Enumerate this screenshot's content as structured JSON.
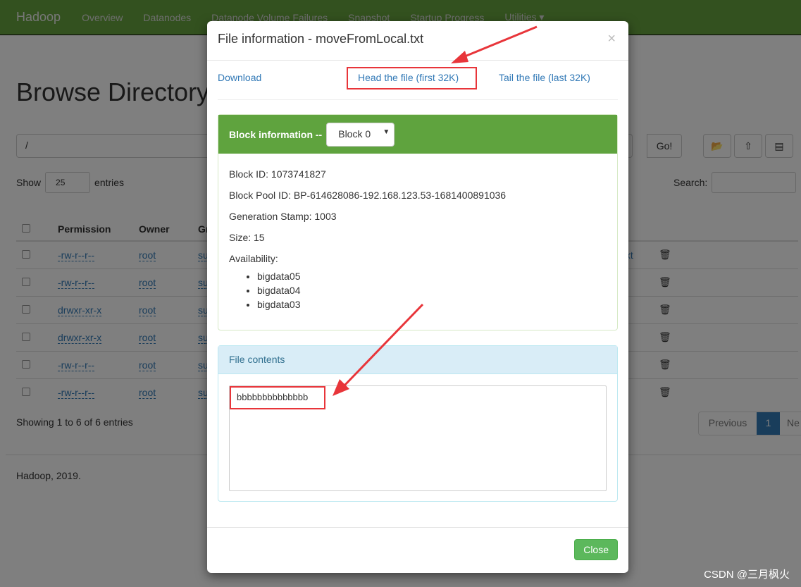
{
  "nav": {
    "brand": "Hadoop",
    "items": [
      "Overview",
      "Datanodes",
      "Datanode Volume Failures",
      "Snapshot",
      "Startup Progress",
      "Utilities ▾"
    ]
  },
  "page": {
    "title": "Browse Directory",
    "path": "/",
    "go": "Go!",
    "show": "Show",
    "entries_value": "25",
    "entries": "entries",
    "search": "Search:",
    "columns": [
      "Permission",
      "Owner",
      "Gr"
    ],
    "rows": [
      [
        "-rw-r--r--",
        "root",
        "su"
      ],
      [
        "-rw-r--r--",
        "root",
        "su"
      ],
      [
        "drwxr-xr-x",
        "root",
        "su"
      ],
      [
        "drwxr-xr-x",
        "root",
        "su"
      ],
      [
        "-rw-r--r--",
        "root",
        "su"
      ],
      [
        "-rw-r--r--",
        "root",
        "su"
      ]
    ],
    "row0_name_tail": "l.txt",
    "showing": "Showing 1 to 6 of 6 entries",
    "previous": "Previous",
    "page_num": "1",
    "next": "Ne",
    "footer": "Hadoop, 2019."
  },
  "modal": {
    "title": "File information - moveFromLocal.txt",
    "close_x": "×",
    "download": "Download",
    "head": "Head the file (first 32K)",
    "tail": "Tail the file (last 32K)",
    "block_label": "Block information --",
    "block_select": "Block 0",
    "block_id": "Block ID: 1073741827",
    "pool_id": "Block Pool ID: BP-614628086-192.168.123.53-1681400891036",
    "gen_stamp": "Generation Stamp: 1003",
    "size": "Size: 15",
    "availability": "Availability:",
    "nodes": [
      "bigdata05",
      "bigdata04",
      "bigdata03"
    ],
    "contents_label": "File contents",
    "contents": "bbbbbbbbbbbbbb",
    "close": "Close"
  },
  "watermark": "CSDN @三月枫火",
  "colors": {
    "navbar": "#67a33f",
    "panel_header": "#5fa33e",
    "annotation": "#e8353a",
    "close_button": "#5cb85c"
  }
}
